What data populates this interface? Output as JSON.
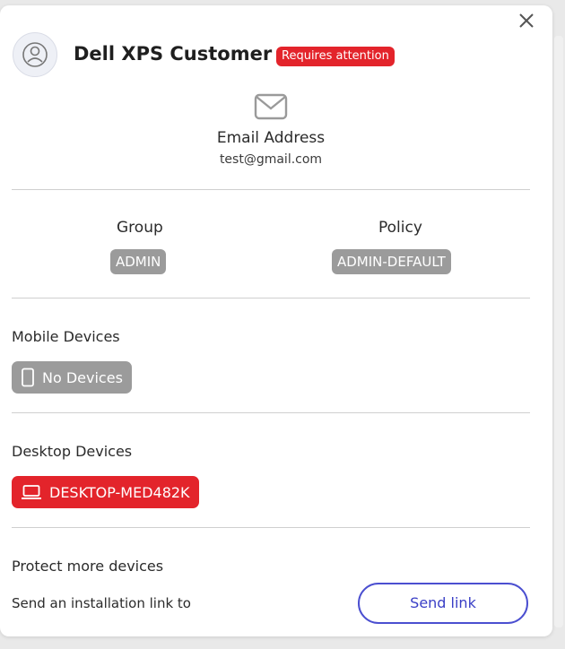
{
  "profile": {
    "name": "Dell XPS Customer",
    "status_badge": "Requires attention",
    "email_label": "Email Address",
    "email_value": "test@gmail.com"
  },
  "group": {
    "label": "Group",
    "value": "ADMIN"
  },
  "policy": {
    "label": "Policy",
    "value": "ADMIN-DEFAULT"
  },
  "mobile": {
    "label": "Mobile Devices",
    "device": "No Devices"
  },
  "desktop": {
    "label": "Desktop Devices",
    "device": "DESKTOP-MED482K"
  },
  "protect": {
    "label": "Protect more devices",
    "description": "Send an installation link to",
    "button": "Send link"
  },
  "icons": {
    "close": "close-icon",
    "avatar": "user-icon",
    "email": "mail-icon",
    "mobile": "phone-icon",
    "desktop": "laptop-icon"
  },
  "colors": {
    "alert_red": "#e3242b",
    "chip_gray": "#9b9b9b",
    "accent_blue": "#4b4fd0"
  }
}
